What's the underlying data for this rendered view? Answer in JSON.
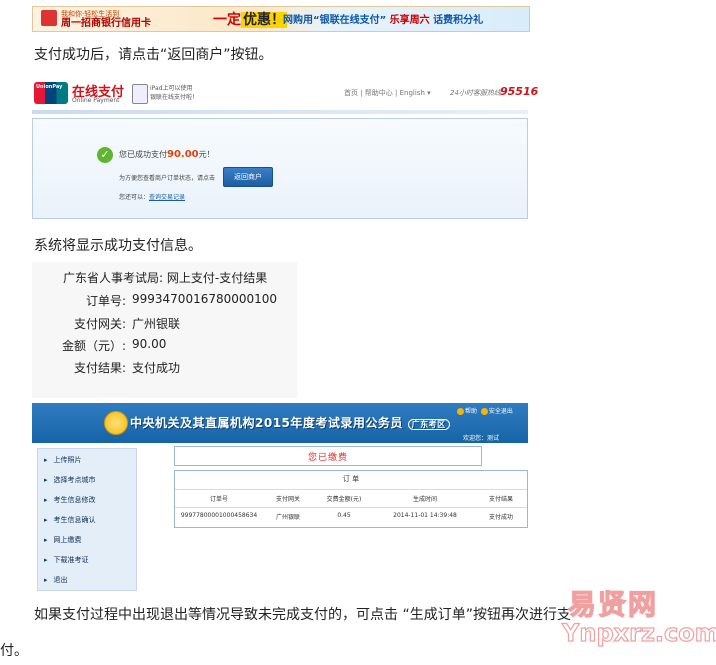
{
  "banner": {
    "text_top": "我和你·轻松生活到",
    "text_main": "周一招商银行信用卡",
    "big_text": "一定",
    "big_highlight": "优惠！",
    "right_text": "网购用“银联在线支付”",
    "right_tag": "乐享周六",
    "right_tail": "话费积分礼"
  },
  "instruction1": "支付成功后，请点击“返回商户”按钮。",
  "unionpay": {
    "logo_text": "UnionPay",
    "title": "在线支付",
    "subtitle": "Online Payment",
    "ipad_line1": "iPad上可以使用",
    "ipad_line2": "银联在线支付啦！",
    "nav": "首页 | 帮助中心 | English ▾",
    "hotline_label": "24小时客服热线",
    "hotline_number": "95516",
    "paid_prefix": "您已成功支付",
    "paid_amount": "90.00",
    "paid_suffix": "元！",
    "tip": "为方便您查看商户订单状态，请点击",
    "return_button": "返回商户",
    "ask_label": "您还可以：",
    "ask_link": "查询交易记录"
  },
  "instruction2": "系统将显示成功支付信息。",
  "result": {
    "heading": "广东省人事考试局: 网上支付-支付结果",
    "order_label": "订单号:",
    "order_value": "9993470016780000100",
    "gateway_label": "支付网关:",
    "gateway_value": "广州银联",
    "amount_label": "金额（元）:",
    "amount_value": "90.00",
    "status_label": "支付结果:",
    "status_value": "支付成功"
  },
  "system": {
    "title": "中央机关及其直属机构2015年度考试录用公务员",
    "region": "广东考区",
    "help_link": "帮助",
    "logout_link": "安全退出",
    "welcome": "欢迎您：测试",
    "sidebar": [
      "上传照片",
      "选择考点城市",
      "考生信息修改",
      "考生信息确认",
      "网上缴费",
      "下载准考证",
      "退出"
    ],
    "paid_banner": "您已缴费",
    "order_caption": "订 单",
    "order_headers": [
      "订单号",
      "支付网关",
      "交费金额(元)",
      "生成时间",
      "支付结果"
    ],
    "order_row": [
      "99977800001000458634",
      "广州银联",
      "0.45",
      "2014-11-01 14:39:48",
      "支付成功"
    ]
  },
  "instruction3_line1": "如果支付过程中出现退出等情况导致未完成支付的，可点击 “生成订单”按钮再次进行支",
  "instruction3_line2": "付。",
  "watermark": {
    "cn": "易贤网",
    "url": "Ynpxrz.com"
  }
}
